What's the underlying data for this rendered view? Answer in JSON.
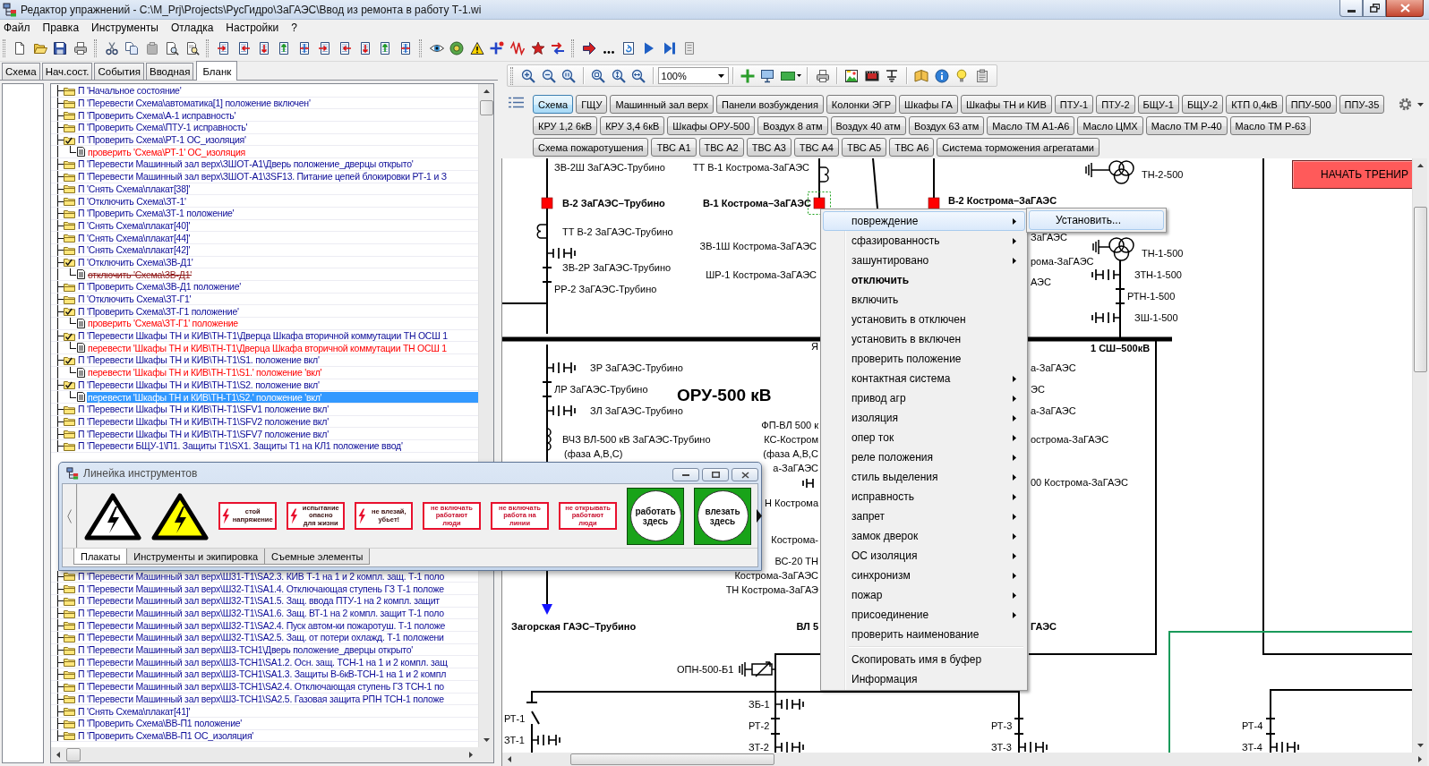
{
  "window": {
    "title": "Редактор упражнений - C:\\M_Prj\\Projects\\РусГидро\\ЗаГАЭС\\Ввод из ремонта в работу Т-1.wi"
  },
  "menu_bar": [
    "Файл",
    "Правка",
    "Инструменты",
    "Отладка",
    "Настройки",
    "?"
  ],
  "left_panel": {
    "tabs": [
      {
        "label": "Схема",
        "selected": false
      },
      {
        "label": "Нач.сост.",
        "selected": false
      },
      {
        "label": "События",
        "selected": false
      },
      {
        "label": "Вводная",
        "selected": false
      },
      {
        "label": "Бланк",
        "selected": true
      }
    ],
    "tree": [
      {
        "text": "П 'Начальное состояние'",
        "expanded": false,
        "selected": false
      },
      {
        "text": "П 'Перевести Схема\\автоматика[1] положение включен'",
        "expanded": false,
        "selected": false
      },
      {
        "text": "П 'Проверить Схема\\А-1 исправность'",
        "expanded": false,
        "selected": false
      },
      {
        "text": "П 'Проверить Схема\\ПТУ-1 исправность'",
        "expanded": false,
        "selected": false
      },
      {
        "text": "П 'Проверить Схема\\РТ-1 ОС_изоляция'",
        "expanded": true,
        "selected": false,
        "children": [
          {
            "text": "проверить 'Схема\\РТ-1' ОС_изоляция",
            "crossed_out": false,
            "selected": false
          }
        ]
      },
      {
        "text": "П 'Перевести Машинный зал верх\\ЗШОТ-А1\\Дверь положение_дверцы открыто'",
        "expanded": false,
        "selected": false
      },
      {
        "text": "П 'Перевести Машинный зал верх\\ЗШОТ-А1\\3SF13. Питание цепей блокировки РТ-1 и З",
        "expanded": false,
        "selected": false
      },
      {
        "text": "П 'Снять Схема\\плакат[38]'",
        "expanded": false,
        "selected": false
      },
      {
        "text": "П 'Отключить Схема\\ЗТ-1'",
        "expanded": false,
        "selected": false
      },
      {
        "text": "П 'Проверить Схема\\ЗТ-1 положение'",
        "expanded": false,
        "selected": false
      },
      {
        "text": "П 'Снять Схема\\плакат[40]'",
        "expanded": false,
        "selected": false
      },
      {
        "text": "П 'Снять Схема\\плакат[44]'",
        "expanded": false,
        "selected": false
      },
      {
        "text": "П 'Снять Схема\\плакат[42]'",
        "expanded": false,
        "selected": false
      },
      {
        "text": "П 'Отключить Схема\\ЗВ-Д1'",
        "expanded": true,
        "selected": false,
        "children": [
          {
            "text": "отключить 'Схема\\ЗВ-Д1'",
            "crossed_out": true,
            "selected": false
          }
        ]
      },
      {
        "text": "П 'Проверить Схема\\ЗВ-Д1 положение'",
        "expanded": false,
        "selected": false
      },
      {
        "text": "П 'Отключить Схема\\ЗТ-Г1'",
        "expanded": false,
        "selected": false
      },
      {
        "text": "П 'Проверить Схема\\ЗТ-Г1 положение'",
        "expanded": true,
        "selected": false,
        "children": [
          {
            "text": "проверить 'Схема\\ЗТ-Г1' положение",
            "crossed_out": false,
            "selected": false
          }
        ]
      },
      {
        "text": "П 'Перевести Шкафы ТН и КИВ\\ТН-Т1\\Дверца Шкафа вторичной коммутации ТН ОСШ 1",
        "expanded": true,
        "selected": false,
        "children": [
          {
            "text": "перевести 'Шкафы ТН и КИВ\\ТН-Т1\\Дверца Шкафа вторичной коммутации ТН ОСШ 1",
            "crossed_out": false,
            "selected": false
          }
        ]
      },
      {
        "text": "П 'Перевести Шкафы ТН и КИВ\\ТН-Т1\\S1. положение вкл'",
        "expanded": true,
        "selected": false,
        "children": [
          {
            "text": "перевести 'Шкафы ТН и КИВ\\ТН-Т1\\S1.' положение 'вкл'",
            "crossed_out": false,
            "selected": false
          }
        ]
      },
      {
        "text": "П 'Перевести Шкафы ТН и КИВ\\ТН-Т1\\S2. положение вкл'",
        "expanded": true,
        "selected": false,
        "children": [
          {
            "text": "перевести 'Шкафы ТН и КИВ\\ТН-Т1\\S2.' положение 'вкл'",
            "crossed_out": false,
            "selected": true
          }
        ]
      },
      {
        "text": "П 'Перевести Шкафы ТН и КИВ\\ТН-Т1\\SFV1 положение вкл'",
        "expanded": false,
        "selected": false
      },
      {
        "text": "П 'Перевести Шкафы ТН и КИВ\\ТН-Т1\\SFV2 положение вкл'",
        "expanded": false,
        "selected": false
      },
      {
        "text": "П 'Перевести Шкафы ТН и КИВ\\ТН-Т1\\SFV7 положение вкл'",
        "expanded": false,
        "selected": false
      },
      {
        "text": "П 'Перевести БЩУ-1\\П1. Защиты Т1\\SX1. Защиты Т1 на КЛ1 положение ввод'",
        "expanded": false,
        "selected": false
      },
      {
        "text": "П 'Перевести Машинный зал верх\\Ш31-Т1\\SA2.3. КИВ Т-1 на 1 и 2 компл. защ. Т-1 поло",
        "expanded": false,
        "selected": false
      },
      {
        "text": "П 'Перевести Машинный зал верх\\Ш32-Т1\\SA1.4. Отключающая ступень ГЗ Т-1 положе",
        "expanded": false,
        "selected": false
      },
      {
        "text": "П 'Перевести Машинный зал верх\\Ш32-Т1\\SA1.5. Защ. ввода ПТУ-1 на 2 компл. защит",
        "expanded": false,
        "selected": false
      },
      {
        "text": "П 'Перевести Машинный зал верх\\Ш32-Т1\\SA1.6. Защ. ВТ-1 на 2 компл. защит Т-1 поло",
        "expanded": false,
        "selected": false
      },
      {
        "text": "П 'Перевести Машинный зал верх\\Ш32-Т1\\SA2.4. Пуск автом-ки пожаротуш. Т-1 положе",
        "expanded": false,
        "selected": false
      },
      {
        "text": "П 'Перевести Машинный зал верх\\Ш32-Т1\\SA2.5. Защ. от потери охлажд. Т-1 положени",
        "expanded": false,
        "selected": false
      },
      {
        "text": "П 'Перевести Машинный зал верх\\Ш3-ТСН1\\Дверь положение_дверцы открыто'",
        "expanded": false,
        "selected": false
      },
      {
        "text": "П 'Перевести Машинный зал верх\\Ш3-ТСН1\\SA1.2. Осн. защ. ТСН-1 на 1 и 2 компл. защ",
        "expanded": false,
        "selected": false
      },
      {
        "text": "П 'Перевести Машинный зал верх\\Ш3-ТСН1\\SA1.3. Защиты В-6кВ-ТСН-1 на 1 и 2 компл",
        "expanded": false,
        "selected": false
      },
      {
        "text": "П 'Перевести Машинный зал верх\\Ш3-ТСН1\\SA2.4. Отключающая ступень ГЗ ТСН-1 по",
        "expanded": false,
        "selected": false
      },
      {
        "text": "П 'Перевести Машинный зал верх\\Ш3-ТСН1\\SA2.5. Газовая защита РПН ТСН-1 положе",
        "expanded": false,
        "selected": false
      },
      {
        "text": "П 'Снять Схема\\плакат[41]'",
        "expanded": false,
        "selected": false
      },
      {
        "text": "П 'Проверить Схема\\ВВ-П1 положение'",
        "expanded": false,
        "selected": false
      },
      {
        "text": "П 'Проверить Схема\\ВВ-П1 ОС_изоляция'",
        "expanded": false,
        "selected": false
      }
    ]
  },
  "tool_palette": {
    "title": "Линейка инструментов",
    "posters": [
      {
        "kind": "warning_triangle",
        "color": "#ffffff"
      },
      {
        "kind": "warning_triangle",
        "color": "#ffff00"
      },
      {
        "kind": "danger_sign",
        "text": "стой\nнапряжение"
      },
      {
        "kind": "danger_sign",
        "text": "испытание\nопасно\nдля жизни"
      },
      {
        "kind": "danger_sign",
        "text": "не влезай,\nубьет!"
      },
      {
        "kind": "prohibit_sign",
        "text": "не включать\nработают\nлюди"
      },
      {
        "kind": "prohibit_sign",
        "text": "не включать\nработа на\nлинии"
      },
      {
        "kind": "prohibit_sign",
        "text": "не открывать\nработают\nлюди"
      },
      {
        "kind": "permit_sign",
        "text": "работать\nздесь"
      },
      {
        "kind": "permit_sign",
        "text": "влезать\nздесь"
      }
    ],
    "tabs": [
      {
        "label": "Плакаты",
        "selected": true
      },
      {
        "label": "Инструменты и экипировка",
        "selected": false
      },
      {
        "label": "Съемные элементы",
        "selected": false
      }
    ]
  },
  "view_toolbar": {
    "zoom": "100%"
  },
  "view_tabs": [
    {
      "tabs": [
        {
          "label": "Схема",
          "selected": true
        },
        {
          "label": "ГЩУ",
          "selected": false
        },
        {
          "label": "Машинный зал верх",
          "selected": false
        },
        {
          "label": "Панели возбуждения",
          "selected": false
        },
        {
          "label": "Колонки ЭГР",
          "selected": false
        },
        {
          "label": "Шкафы ГА",
          "selected": false
        },
        {
          "label": "Шкафы ТН и КИВ",
          "selected": false
        },
        {
          "label": "ПТУ-1",
          "selected": false
        },
        {
          "label": "ПТУ-2",
          "selected": false
        },
        {
          "label": "БЩУ-1",
          "selected": false
        },
        {
          "label": "БЩУ-2",
          "selected": false
        },
        {
          "label": "КТП 0,4кВ",
          "selected": false
        },
        {
          "label": "ППУ-500",
          "selected": false
        },
        {
          "label": "ППУ-35",
          "selected": false
        }
      ]
    },
    {
      "tabs": [
        {
          "label": "КРУ 1,2 6кВ",
          "selected": false
        },
        {
          "label": "КРУ 3,4 6кВ",
          "selected": false
        },
        {
          "label": "Шкафы ОРУ-500",
          "selected": false
        },
        {
          "label": "Воздух 8 атм",
          "selected": false
        },
        {
          "label": "Воздух 40 атм",
          "selected": false
        },
        {
          "label": "Воздух 63 атм",
          "selected": false
        },
        {
          "label": "Масло ТМ А1-А6",
          "selected": false
        },
        {
          "label": "Масло ЦМХ",
          "selected": false
        },
        {
          "label": "Масло ТМ Р-40",
          "selected": false
        },
        {
          "label": "Масло ТМ Р-63",
          "selected": false
        }
      ]
    },
    {
      "tabs": [
        {
          "label": "Схема пожаротушения",
          "selected": false
        },
        {
          "label": "ТВС А1",
          "selected": false
        },
        {
          "label": "ТВС А2",
          "selected": false
        },
        {
          "label": "ТВС А3",
          "selected": false
        },
        {
          "label": "ТВС А4",
          "selected": false
        },
        {
          "label": "ТВС А5",
          "selected": false
        },
        {
          "label": "ТВС А6",
          "selected": false
        },
        {
          "label": "Система торможения агрегатами",
          "selected": false
        }
      ]
    }
  ],
  "diagram": {
    "labels": [
      {
        "text": "ЗВ-2Ш ЗаГАЭС-Трубино",
        "kind": "normal"
      },
      {
        "text": "ТТ В-1 Кострома-ЗаГАЭС",
        "kind": "normal"
      },
      {
        "text": "ТН-2-500",
        "kind": "normal"
      },
      {
        "text": "В-2 ЗаГАЭС–Трубино",
        "kind": "bold"
      },
      {
        "text": "В-1 Кострома–ЗаГАЭС",
        "kind": "bold"
      },
      {
        "text": "В-2 Кострома–ЗаГАЭС",
        "kind": "bold"
      },
      {
        "text": "ТТ В-2 ЗаГАЭС-Трубино",
        "kind": "normal"
      },
      {
        "text": "ЗаГАЭС",
        "kind": "normal"
      },
      {
        "text": "ЗВ-1Ш Кострома-ЗаГАЭС",
        "kind": "normal"
      },
      {
        "text": "ТН-1-500",
        "kind": "normal"
      },
      {
        "text": "рома-ЗаГАЭС",
        "kind": "normal"
      },
      {
        "text": "ЗВ-2Р ЗаГАЭС-Трубино",
        "kind": "normal"
      },
      {
        "text": "ШР-1 Кострома-ЗаГАЭС",
        "kind": "normal"
      },
      {
        "text": "ЗТН-1-500",
        "kind": "normal"
      },
      {
        "text": "АЭС",
        "kind": "normal"
      },
      {
        "text": "РР-2 ЗаГАЭС-Трубино",
        "kind": "normal"
      },
      {
        "text": "РТН-1-500",
        "kind": "normal"
      },
      {
        "text": "ЗШ-1-500",
        "kind": "normal"
      },
      {
        "text": "Я",
        "kind": "normal"
      },
      {
        "text": "1 СШ–500кВ",
        "kind": "bold"
      },
      {
        "text": "ЗР ЗаГАЭС-Трубино",
        "kind": "normal"
      },
      {
        "text": "а-ЗаГАЭС",
        "kind": "normal"
      },
      {
        "text": "ЛР ЗаГАЭС-Трубино",
        "kind": "normal"
      },
      {
        "text": "ЭС",
        "kind": "normal"
      },
      {
        "text": "ОРУ-500 кВ",
        "kind": "title"
      },
      {
        "text": "ЗЛ ЗаГАЭС-Трубино",
        "kind": "normal"
      },
      {
        "text": "а-ЗаГАЭС",
        "kind": "normal"
      },
      {
        "text": "ФП-ВЛ 500 к",
        "kind": "normal"
      },
      {
        "text": "ВЧЗ ВЛ-500 кВ ЗаГАЭС-Трубино",
        "kind": "normal"
      },
      {
        "text": "КС-Костром",
        "kind": "normal"
      },
      {
        "text": "острома-ЗаГАЭС",
        "kind": "normal"
      },
      {
        "text": "(фаза А,В,С)",
        "kind": "normal"
      },
      {
        "text": "(фаза А,В,С",
        "kind": "normal"
      },
      {
        "text": "а-ЗаГАЭС",
        "kind": "normal"
      },
      {
        "text": "00 Кострома-ЗаГАЭС",
        "kind": "normal"
      },
      {
        "text": "Н Кострома",
        "kind": "normal"
      },
      {
        "text": "Кострома-",
        "kind": "normal"
      },
      {
        "text": "ВС-20 ТН",
        "kind": "normal"
      },
      {
        "text": "Кострома-ЗаГАЭС",
        "kind": "normal"
      },
      {
        "text": "ТН Кострома-ЗаГАЭ",
        "kind": "normal"
      },
      {
        "text": "Загорская ГАЭС–Трубино",
        "kind": "bold"
      },
      {
        "text": "ВЛ 5",
        "kind": "bold"
      },
      {
        "text": "ГАЭС",
        "kind": "bold"
      },
      {
        "text": "ОПН-500-Б1",
        "kind": "normal"
      },
      {
        "text": "ЗБ-1",
        "kind": "normal"
      },
      {
        "text": "РТ-1",
        "kind": "normal"
      },
      {
        "text": "РТ-2",
        "kind": "normal"
      },
      {
        "text": "РТ-3",
        "kind": "normal"
      },
      {
        "text": "РТ-4",
        "kind": "normal"
      },
      {
        "text": "ЗТ-1",
        "kind": "normal"
      },
      {
        "text": "ЗТ-2",
        "kind": "normal"
      },
      {
        "text": "ЗТ-3",
        "kind": "normal"
      },
      {
        "text": "ЗТ-4",
        "kind": "normal"
      }
    ],
    "breakers": [
      {
        "on": true,
        "selected": false
      },
      {
        "on": true,
        "selected": true
      },
      {
        "on": true,
        "selected": false
      }
    ],
    "start_button": "НАЧАТЬ ТРЕНИР"
  },
  "context_menu": {
    "groups": [
      {
        "items": [
          {
            "label": "повреждение",
            "has_submenu": true,
            "default": false,
            "selected": true
          },
          {
            "label": "сфазированность",
            "has_submenu": true,
            "default": false,
            "selected": false
          },
          {
            "label": "зашунтировано",
            "has_submenu": true,
            "default": false,
            "selected": false
          },
          {
            "label": "отключить",
            "has_submenu": false,
            "default": true,
            "selected": false
          },
          {
            "label": "включить",
            "has_submenu": false,
            "default": false,
            "selected": false
          },
          {
            "label": "установить в отключен",
            "has_submenu": false,
            "default": false,
            "selected": false
          },
          {
            "label": "установить в включен",
            "has_submenu": false,
            "default": false,
            "selected": false
          },
          {
            "label": "проверить положение",
            "has_submenu": false,
            "default": false,
            "selected": false
          },
          {
            "label": "контактная система",
            "has_submenu": true,
            "default": false,
            "selected": false
          },
          {
            "label": "привод агр",
            "has_submenu": true,
            "default": false,
            "selected": false
          },
          {
            "label": "изоляция",
            "has_submenu": true,
            "default": false,
            "selected": false
          },
          {
            "label": "опер ток",
            "has_submenu": true,
            "default": false,
            "selected": false
          },
          {
            "label": "реле положения",
            "has_submenu": true,
            "default": false,
            "selected": false
          },
          {
            "label": "стиль выделения",
            "has_submenu": true,
            "default": false,
            "selected": false
          },
          {
            "label": "исправность",
            "has_submenu": true,
            "default": false,
            "selected": false
          },
          {
            "label": "запрет",
            "has_submenu": true,
            "default": false,
            "selected": false
          },
          {
            "label": "замок дверок",
            "has_submenu": true,
            "default": false,
            "selected": false
          },
          {
            "label": "ОС изоляция",
            "has_submenu": true,
            "default": false,
            "selected": false
          },
          {
            "label": "синхронизм",
            "has_submenu": true,
            "default": false,
            "selected": false
          },
          {
            "label": "пожар",
            "has_submenu": true,
            "default": false,
            "selected": false
          },
          {
            "label": "присоединение",
            "has_submenu": true,
            "default": false,
            "selected": false
          },
          {
            "label": "проверить наименование",
            "has_submenu": false,
            "default": false,
            "selected": false
          }
        ]
      },
      {
        "items": [
          {
            "label": "Скопировать имя в буфер",
            "has_submenu": false,
            "default": false,
            "selected": false
          },
          {
            "label": "Информация",
            "has_submenu": false,
            "default": false,
            "selected": false
          }
        ]
      }
    ],
    "submenu": [
      {
        "label": "Установить...",
        "selected": true
      }
    ]
  }
}
